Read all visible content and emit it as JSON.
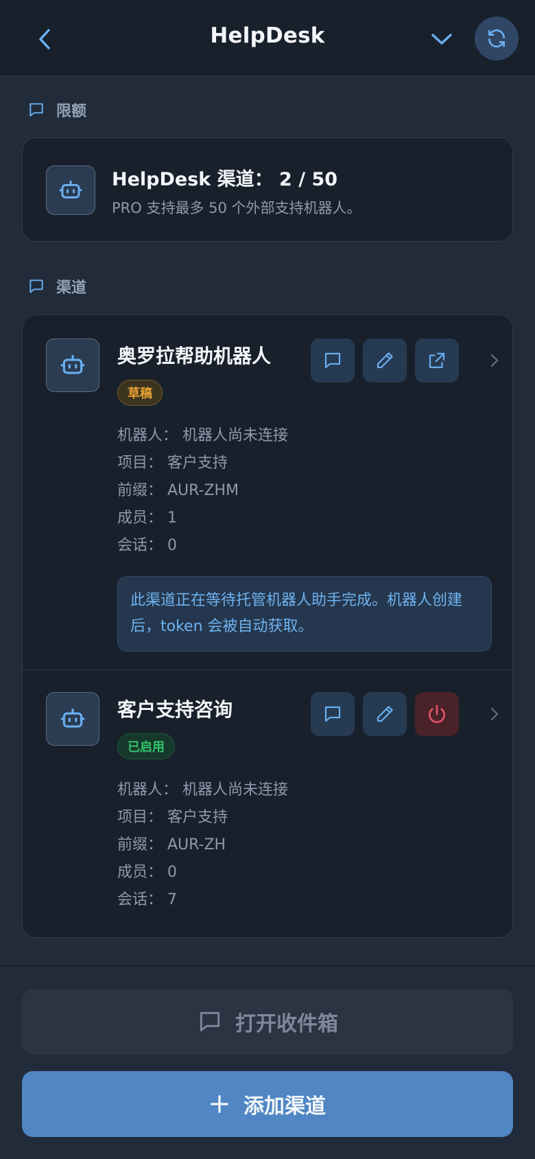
{
  "header": {
    "title": "HelpDesk",
    "back_icon": "chevron-left-icon",
    "menu_icon": "chevron-down-icon",
    "refresh_icon": "refresh-icon"
  },
  "quota": {
    "section_label": "限额",
    "title": "HelpDesk 渠道： 2 / 50",
    "subtitle": "PRO 支持最多 50 个外部支持机器人。"
  },
  "channels_section": {
    "label": "渠道",
    "items": [
      {
        "name": "奥罗拉帮助机器人",
        "status": "草稿",
        "bot": "机器人：  机器人尚未连接",
        "project": "项目：  客户支持",
        "prefix": "前缀：  AUR-ZHM",
        "members": "成员：  1",
        "sessions": "会话：  0",
        "notice": "此渠道正在等待托管机器人助手完成。机器人创建后，token 会被自动获取。",
        "actions": [
          "chat-icon",
          "edit-icon",
          "external-link-icon"
        ]
      },
      {
        "name": "客户支持咨询",
        "status": "已启用",
        "bot": "机器人：  机器人尚未连接",
        "project": "项目：  客户支持",
        "prefix": "前缀：  AUR-ZH",
        "members": "成员：  0",
        "sessions": "会话：  7",
        "actions": [
          "chat-icon",
          "edit-icon",
          "power-icon"
        ]
      }
    ]
  },
  "footer": {
    "inbox_label": "打开收件箱",
    "add_label": "添加渠道"
  },
  "colors": {
    "accent": "#4f86c3",
    "draft": "#e9a232",
    "enabled": "#32c46c",
    "danger": "#e25563",
    "link": "#6fb2ef"
  }
}
